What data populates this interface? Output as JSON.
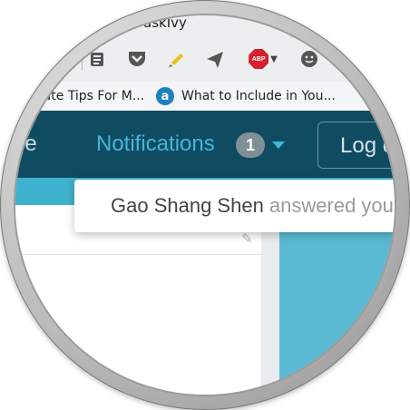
{
  "browser": {
    "tab": {
      "title": "askIvy",
      "close_glyph": "×"
    },
    "toolbar_icons": [
      "clipboard-icon",
      "pocket-icon",
      "highlighter-icon",
      "send-icon",
      "adblock-plus-icon",
      "emoji-icon"
    ],
    "abp_label": "ABP",
    "bookmarks": [
      {
        "label": "mate Tips For M..."
      },
      {
        "icon_letter": "a",
        "label": "What to Include in You..."
      }
    ]
  },
  "site_nav": {
    "profile_label": "file",
    "notifications_label": "Notifications",
    "notifications_count": "1",
    "login_label": "Log o"
  },
  "notification_dropdown": {
    "items": [
      {
        "name": "Gao Shang Shen",
        "action": " answered you"
      }
    ]
  },
  "colors": {
    "nav_bg": "#0f4c61",
    "nav_link": "#43b6e0",
    "accent": "#3fb2cf",
    "badge": "#7f8f96",
    "abp_red": "#d6202f"
  }
}
